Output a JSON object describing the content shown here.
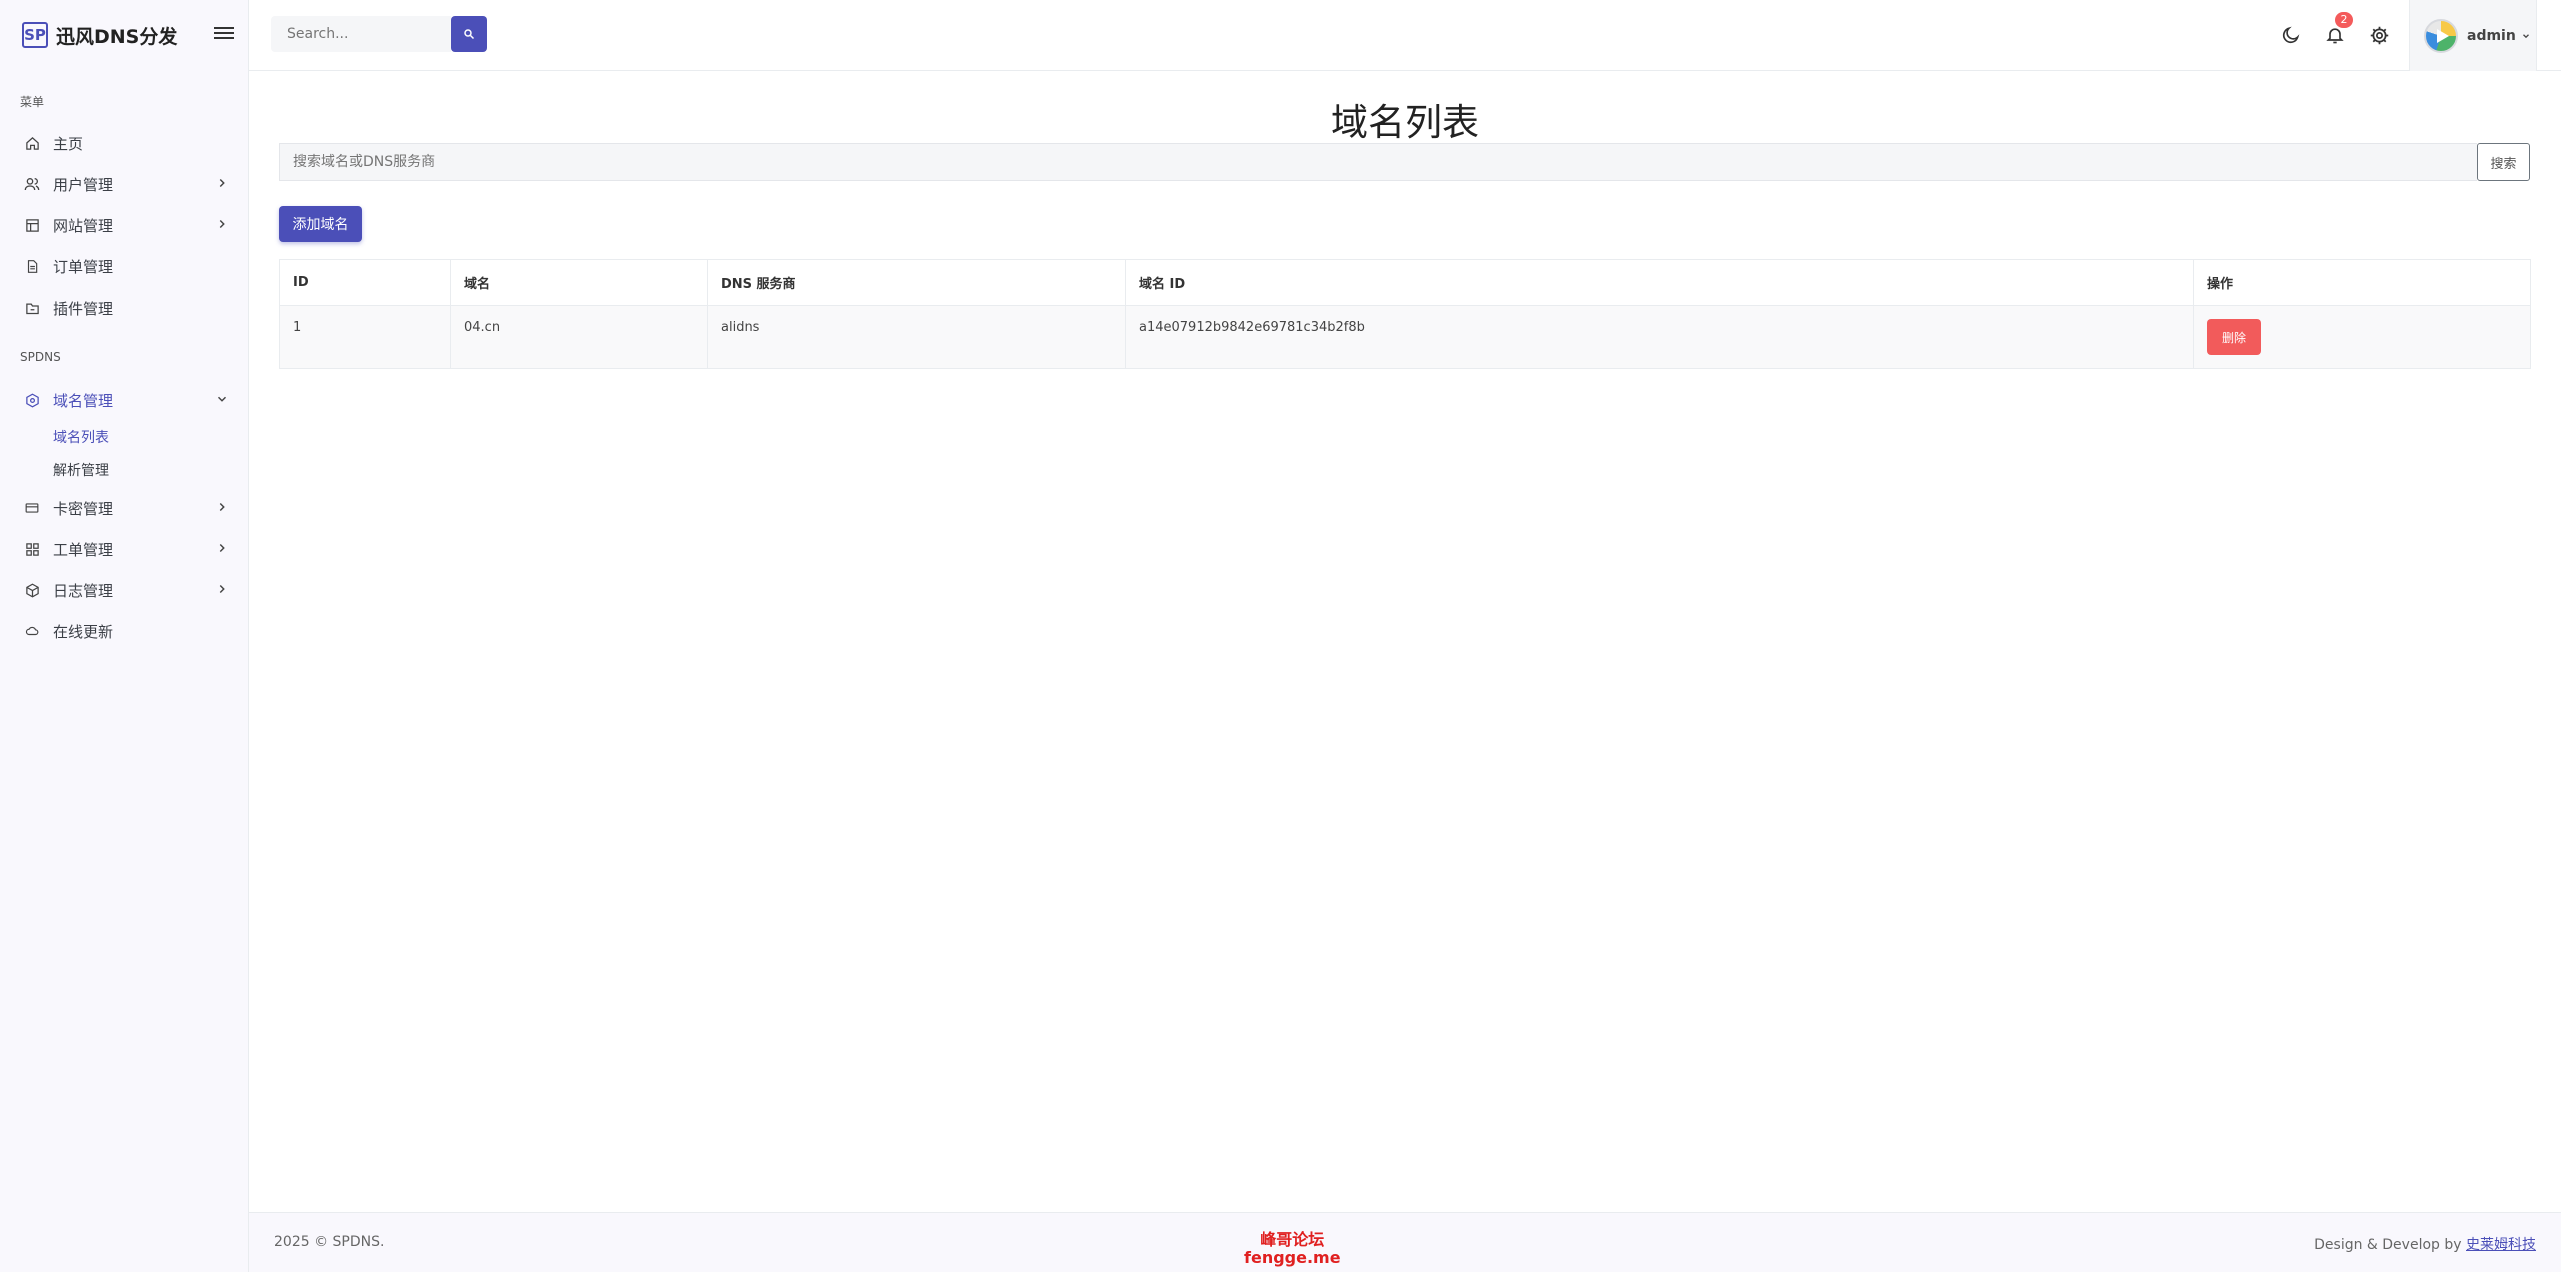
{
  "brand": {
    "logo": "SP",
    "name": "迅风DNS分发"
  },
  "sidebar": {
    "heading_menu": "菜单",
    "heading_spdns": "SPDNS",
    "items": [
      {
        "label": "主页",
        "icon": "home-icon"
      },
      {
        "label": "用户管理",
        "icon": "users-icon"
      },
      {
        "label": "网站管理",
        "icon": "layout-icon"
      },
      {
        "label": "订单管理",
        "icon": "file-icon"
      },
      {
        "label": "插件管理",
        "icon": "folder-icon"
      }
    ],
    "spdns_items": [
      {
        "label": "域名管理",
        "icon": "cube-icon",
        "expanded": true,
        "children": [
          {
            "label": "域名列表",
            "active": true
          },
          {
            "label": "解析管理"
          }
        ]
      },
      {
        "label": "卡密管理",
        "icon": "card-icon"
      },
      {
        "label": "工单管理",
        "icon": "grid-icon"
      },
      {
        "label": "日志管理",
        "icon": "box-icon"
      },
      {
        "label": "在线更新",
        "icon": "cloud-icon"
      }
    ]
  },
  "topbar": {
    "search_placeholder": "Search...",
    "notification_count": "2",
    "user_name": "admin"
  },
  "main": {
    "title": "域名列表",
    "search_placeholder": "搜索域名或DNS服务商",
    "search_button": "搜索",
    "add_button": "添加域名",
    "table": {
      "headers": [
        "ID",
        "域名",
        "DNS 服务商",
        "域名 ID",
        "操作"
      ],
      "rows": [
        {
          "id": "1",
          "domain": "04.cn",
          "provider": "alidns",
          "domain_id": "a14e07912b9842e69781c34b2f8b",
          "action": "删除"
        }
      ]
    }
  },
  "footer": {
    "copyright": "2025 © SPDNS.",
    "watermark_line1": "峰哥论坛",
    "watermark_line2": "fengge.me",
    "credit_prefix": "Design & Develop by",
    "credit_link": "史莱姆科技"
  },
  "colors": {
    "accent": "#4b4fb8",
    "danger": "#f25b5b",
    "badge": "#f45b5b"
  }
}
